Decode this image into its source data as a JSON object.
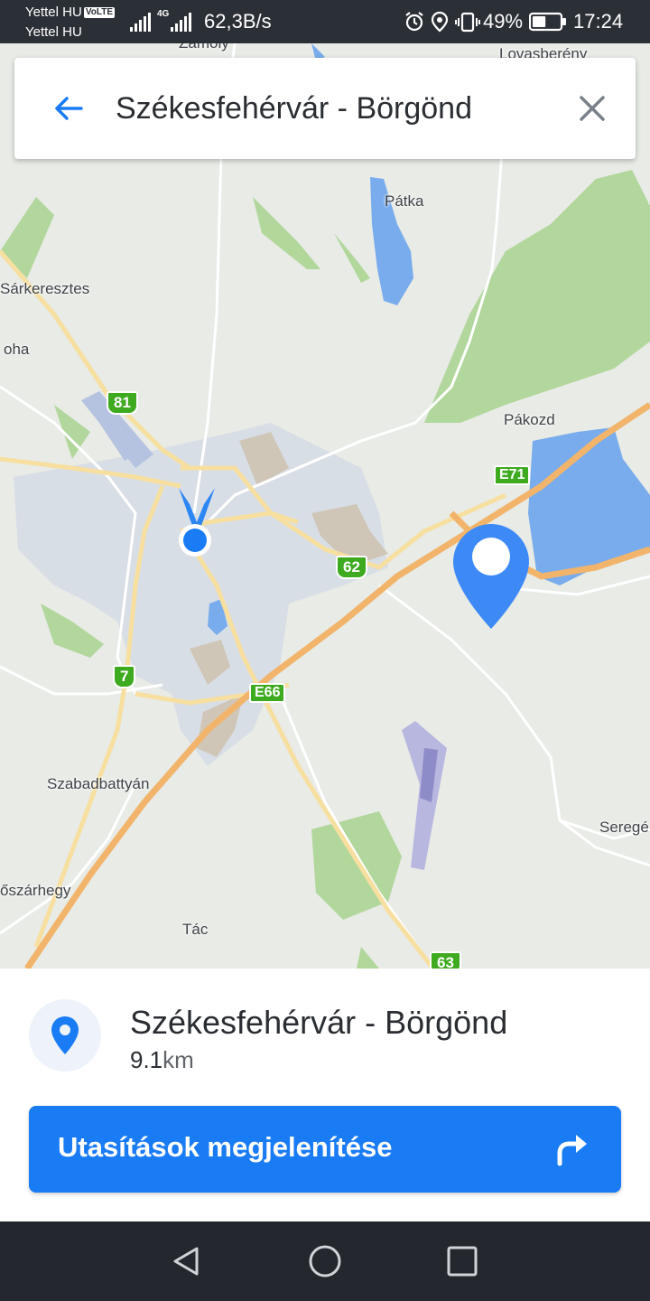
{
  "status_bar": {
    "carrier1": "Yettel HU",
    "volte_badge": "VoLTE",
    "carrier2": "Yettel HU",
    "network_type": "4G",
    "data_speed": "62,3B/s",
    "battery_percent": "49%",
    "battery_level": 0.49,
    "time": "17:24"
  },
  "search": {
    "query": "Székesfehérvár - Börgönd"
  },
  "map": {
    "labels": {
      "zamoly": "Zámoly",
      "lovasbereny": "Lovasberény",
      "patka": "Pátka",
      "sarkeresztes": "Sárkeresztes",
      "moha": "oha",
      "pakozd": "Pákozd",
      "szabadbattyan": "Szabadbattyán",
      "seregelyes": "Seregé",
      "urhida": "őszárhegy",
      "tac": "Tác"
    },
    "shields": {
      "r81": "81",
      "e71": "E71",
      "r62": "62",
      "r7": "7",
      "e66": "E66",
      "r63": "63"
    },
    "colors": {
      "land": "#e8ebe6",
      "forest": "#a8d48f",
      "water": "#78acec",
      "urban": "#d8dee6",
      "motorway": "#f2b46b",
      "road": "#ffffff"
    }
  },
  "result": {
    "name": "Székesfehérvár - Börgönd",
    "distance_value": "9.1",
    "distance_unit": "km"
  },
  "directions_button": {
    "label": "Utasítások megjelenítése"
  },
  "accent_color": "#1a7cf5"
}
